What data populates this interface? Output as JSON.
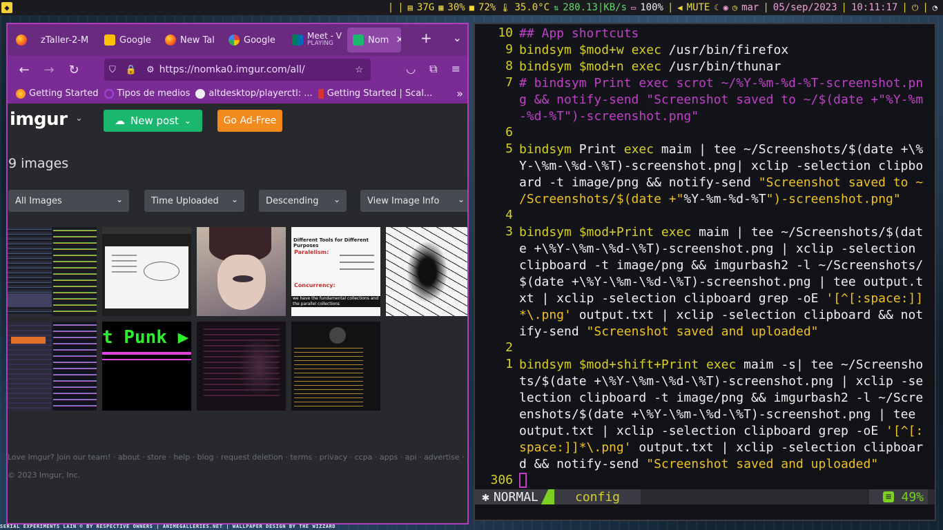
{
  "statusbar": {
    "disk": "37G",
    "cpu": "30%",
    "mem": "72%",
    "temp": "35.0°C",
    "net": "280.13|KB/s",
    "battery": "100%",
    "volume": "MUTE",
    "day": "mar",
    "date": "05/sep/2023",
    "time": "10:11:17"
  },
  "wallpaper_caption": "SERIAL EXPERIMENTS LAIN © BY RESPECTIVE OWNERS | ANIMEGALLERIES.NET | WALLPAPER DESIGN BY THE WIZZARD",
  "browser": {
    "tabs": [
      {
        "label": "zTaller-2-M",
        "icon": "firefox-icon"
      },
      {
        "label": "Google",
        "icon": "gmail-icon"
      },
      {
        "label": "New Tal",
        "icon": "firefox-icon"
      },
      {
        "label": "Google",
        "icon": "google-icon"
      },
      {
        "label": "Meet - V",
        "sublabel": "PLAYING",
        "icon": "meet-icon"
      },
      {
        "label": "Nom",
        "icon": "imgur-icon",
        "active": true
      }
    ],
    "url": "https://nomka0.imgur.com/all/",
    "bookmarks": [
      {
        "label": "Getting Started",
        "color": "#ff7a1a"
      },
      {
        "label": "Tipos de medios",
        "color": "#a040e0"
      },
      {
        "label": "altdesktop/playerctl: ...",
        "color": "#ffffff"
      },
      {
        "label": "Getting Started | Scal...",
        "color": "#dc322f"
      }
    ]
  },
  "imgur": {
    "logo": "imgur",
    "new_post": "New post",
    "go_adfree": "Go Ad-Free",
    "image_count": "9 images",
    "filters": [
      "All Images",
      "Time Uploaded",
      "Descending",
      "View Image Info"
    ],
    "footer_links": "Love Imgur? Join our team! · about · store · help · blog · request deletion · terms · privacy · ccpa · apps · api · advertise · ad choices",
    "copyright": "© 2023 Imgur, Inc.",
    "thumb_texts": {
      "t4_title": "Different Tools for Different Purposes",
      "t4_line1": "Paralelism:",
      "t4_line2": "Concurrency:",
      "t4_caption": "we have the fundamental collections and the parallel collections",
      "t7_text": "t Punk ▶"
    }
  },
  "terminal": {
    "lines": [
      {
        "num": "10",
        "segments": [
          {
            "t": "## App shortcuts",
            "c": "com"
          }
        ]
      },
      {
        "num": "9",
        "segments": [
          {
            "t": "bindsym $mod+w ",
            "c": "kw"
          },
          {
            "t": "exec",
            "c": "kw"
          },
          {
            "t": " /usr/bin/firefox",
            "c": "def"
          }
        ]
      },
      {
        "num": "8",
        "segments": [
          {
            "t": "bindsym $mod+n ",
            "c": "kw"
          },
          {
            "t": "exec",
            "c": "kw"
          },
          {
            "t": " /usr/bin/thunar",
            "c": "def"
          }
        ]
      },
      {
        "num": "7",
        "segments": [
          {
            "t": "# bindsym Print exec scrot ~/%Y-%m-%d-%T-screenshot.pn\ng && notify-send \"Screenshot saved to ~/$(date +\"%Y-%m\n-%d-%T\")-screenshot.png\"",
            "c": "com"
          }
        ]
      },
      {
        "num": "6",
        "segments": []
      },
      {
        "num": "5",
        "segments": [
          {
            "t": "bindsym ",
            "c": "kw"
          },
          {
            "t": "Print ",
            "c": "def"
          },
          {
            "t": "exec",
            "c": "kw"
          },
          {
            "t": " maim | tee ~/Screenshots/$(date +\\%\nY-\\%m-\\%d-\\%T)-screenshot.png| xclip -selection clipbo\nard -t image/png && notify-send ",
            "c": "def"
          },
          {
            "t": "\"Screenshot saved to ~\n/Screenshots/$(date +\"",
            "c": "str"
          },
          {
            "t": "%Y-%m-%d-%T",
            "c": "def"
          },
          {
            "t": "\")-screenshot.png\"",
            "c": "str"
          }
        ]
      },
      {
        "num": "4",
        "segments": []
      },
      {
        "num": "3",
        "segments": [
          {
            "t": "bindsym $mod+Print ",
            "c": "kw"
          },
          {
            "t": "exec",
            "c": "kw"
          },
          {
            "t": " maim | tee ~/Screenshots/$(dat\ne +\\%Y-\\%m-\\%d-\\%T)-screenshot.png | xclip -selection\nclipboard -t image/png && imgurbash2 -l ~/Screenshots/\n$(date +\\%Y-\\%m-\\%d-\\%T)-screenshot.png | tee output.t\nxt | xclip -selection clipboard grep -oE ",
            "c": "def"
          },
          {
            "t": "'[^[:space:]]\n*\\.png'",
            "c": "str"
          },
          {
            "t": " output.txt | xclip -selection clipboard && not\nify-send ",
            "c": "def"
          },
          {
            "t": "\"Screenshot saved and uploaded\"",
            "c": "str"
          }
        ]
      },
      {
        "num": "2",
        "segments": []
      },
      {
        "num": "1",
        "segments": [
          {
            "t": "bindsym $mod+shift+Print ",
            "c": "kw"
          },
          {
            "t": "exec",
            "c": "kw"
          },
          {
            "t": " maim -s| tee ~/Screensho\nts/$(date +\\%Y-\\%m-\\%d-\\%T)-screenshot.png | xclip -se\nlection clipboard -t image/png && imgurbash2 -l ~/Scre\nenshots/$(date +\\%Y-\\%m-\\%d-\\%T)-screenshot.png | tee\noutput.txt | xclip -selection clipboard grep -oE ",
            "c": "def"
          },
          {
            "t": "'[^[:\nspace:]]*\\.png'",
            "c": "str"
          },
          {
            "t": " output.txt | xclip -selection clipboar\nd && notify-send ",
            "c": "def"
          },
          {
            "t": "\"Screenshot saved and uploaded\"",
            "c": "str"
          }
        ]
      },
      {
        "num": "306",
        "segments": []
      }
    ],
    "mode": "NORMAL",
    "filename": "config",
    "percent": "49%"
  }
}
